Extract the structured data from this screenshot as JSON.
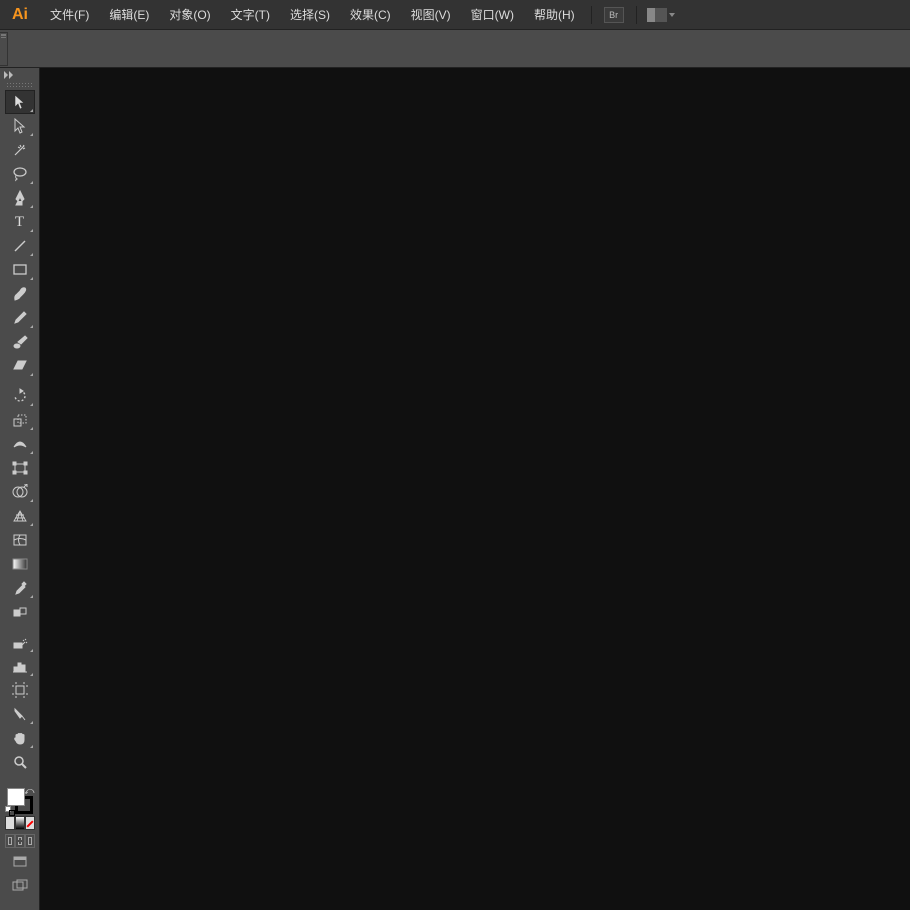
{
  "app": {
    "logo": "Ai"
  },
  "menu": {
    "items": [
      {
        "label": "文件(F)"
      },
      {
        "label": "编辑(E)"
      },
      {
        "label": "对象(O)"
      },
      {
        "label": "文字(T)"
      },
      {
        "label": "选择(S)"
      },
      {
        "label": "效果(C)"
      },
      {
        "label": "视图(V)"
      },
      {
        "label": "窗口(W)"
      },
      {
        "label": "帮助(H)"
      }
    ],
    "bridge_label": "Br"
  },
  "tools": [
    {
      "name": "selection-tool",
      "selected": true
    },
    {
      "name": "direct-selection-tool"
    },
    {
      "name": "magic-wand-tool"
    },
    {
      "name": "lasso-tool"
    },
    {
      "name": "pen-tool"
    },
    {
      "name": "type-tool"
    },
    {
      "name": "line-segment-tool"
    },
    {
      "name": "rectangle-tool"
    },
    {
      "name": "paintbrush-tool"
    },
    {
      "name": "pencil-tool"
    },
    {
      "name": "blob-brush-tool"
    },
    {
      "name": "eraser-tool"
    },
    {
      "name": "rotate-tool"
    },
    {
      "name": "scale-tool"
    },
    {
      "name": "width-tool"
    },
    {
      "name": "free-transform-tool"
    },
    {
      "name": "shape-builder-tool"
    },
    {
      "name": "perspective-grid-tool"
    },
    {
      "name": "mesh-tool"
    },
    {
      "name": "gradient-tool"
    },
    {
      "name": "eyedropper-tool"
    },
    {
      "name": "blend-tool"
    },
    {
      "name": "symbol-sprayer-tool"
    },
    {
      "name": "column-graph-tool"
    },
    {
      "name": "artboard-tool"
    },
    {
      "name": "slice-tool"
    },
    {
      "name": "hand-tool"
    },
    {
      "name": "zoom-tool"
    }
  ],
  "color": {
    "fill": "#ffffff",
    "stroke": "#000000"
  }
}
